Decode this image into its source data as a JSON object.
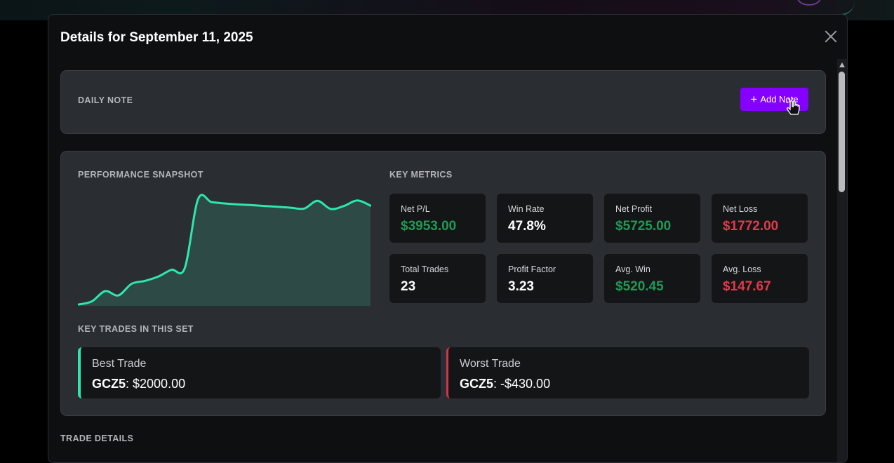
{
  "modal": {
    "title": "Details for September 11, 2025"
  },
  "daily_note": {
    "label": "DAILY NOTE",
    "add_button": "Add Note"
  },
  "performance": {
    "snapshot_label": "PERFORMANCE SNAPSHOT",
    "key_metrics_label": "KEY METRICS",
    "metrics": [
      {
        "label": "Net P/L",
        "value": "$3953.00",
        "tone": "green"
      },
      {
        "label": "Win Rate",
        "value": "47.8%",
        "tone": "white"
      },
      {
        "label": "Net Profit",
        "value": "$5725.00",
        "tone": "green"
      },
      {
        "label": "Net Loss",
        "value": "$1772.00",
        "tone": "red"
      },
      {
        "label": "Total Trades",
        "value": "23",
        "tone": "white"
      },
      {
        "label": "Profit Factor",
        "value": "3.23",
        "tone": "white"
      },
      {
        "label": "Avg. Win",
        "value": "$520.45",
        "tone": "green"
      },
      {
        "label": "Avg. Loss",
        "value": "$147.67",
        "tone": "red"
      }
    ],
    "key_trades_label": "KEY TRADES IN THIS SET",
    "best_trade": {
      "title": "Best Trade",
      "symbol": "GCZ5",
      "amount": ": $2000.00"
    },
    "worst_trade": {
      "title": "Worst Trade",
      "symbol": "GCZ5",
      "amount": ": -$430.00"
    }
  },
  "trade_details_label": "TRADE DETAILS",
  "chart_data": {
    "type": "area",
    "x": [
      1,
      2,
      3,
      4,
      5,
      6,
      7,
      8,
      9,
      10,
      11,
      12,
      13,
      14,
      15,
      16,
      17,
      18,
      19,
      20,
      21,
      22,
      23
    ],
    "values": [
      -430,
      -250,
      350,
      100,
      780,
      950,
      1200,
      1600,
      1700,
      5725,
      5560,
      5480,
      5420,
      5380,
      5330,
      5280,
      5230,
      5180,
      5630,
      5160,
      5330,
      5650,
      5350
    ],
    "colors": {
      "line": "#2de6b0",
      "fill": "#2e4a46"
    }
  }
}
